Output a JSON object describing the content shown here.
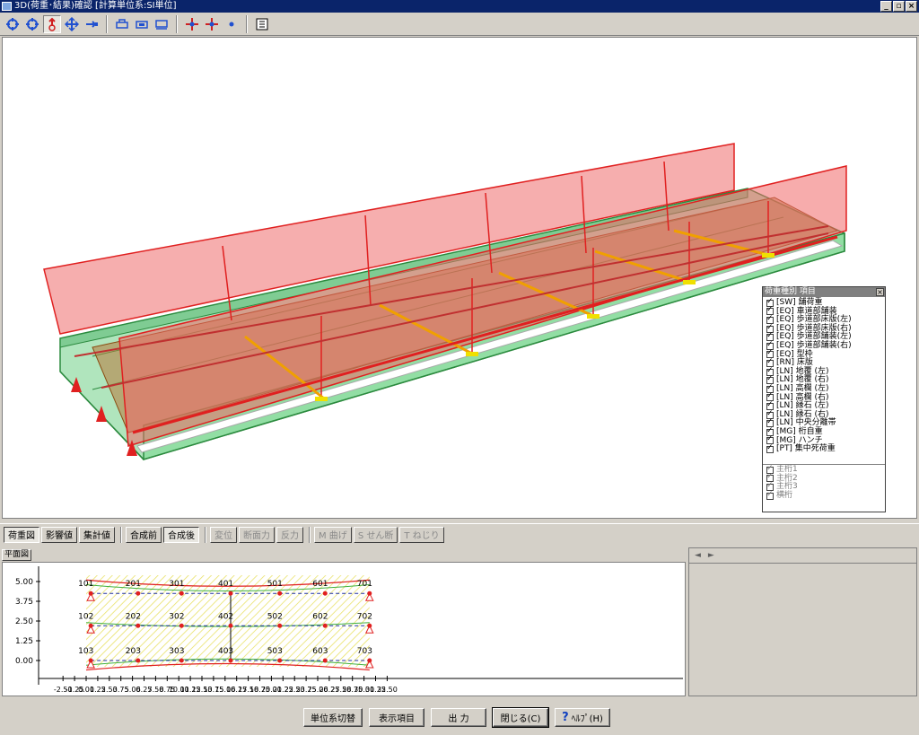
{
  "window": {
    "title": "3D(荷重･結果)確認 [計算単位系:SI単位]"
  },
  "toolbar": {
    "icons": [
      "rotate-x-icon",
      "rotate-y-icon",
      "rotate-z-icon",
      "move-icon",
      "zoom-icon",
      "front-view-icon",
      "side-view-icon",
      "top-view-icon",
      "node-icon",
      "member-icon",
      "point-icon",
      "settings-icon"
    ]
  },
  "legend": {
    "title": "荷重種別 項目",
    "items": [
      "[SW] 舗荷重",
      "[EQ] 車道部舗装",
      "[EQ] 歩道部床版(左)",
      "[EQ] 歩道部床版(右)",
      "[EQ] 歩道部舗装(左)",
      "[EQ] 歩道部舗装(右)",
      "[EQ] 型枠",
      "[RN] 床版",
      "[LN] 地覆 (左)",
      "[LN] 地覆 (右)",
      "[LN] 高欄 (左)",
      "[LN] 高欄 (右)",
      "[LN] 縁石 (左)",
      "[LN] 縁石 (右)",
      "[LN] 中央分離帯",
      "[MG] 桁自重",
      "[MG] ハンチ",
      "[PT] 集中死荷重"
    ],
    "girders": [
      "主桁1",
      "主桁2",
      "主桁3",
      "横桁"
    ]
  },
  "tabs": {
    "group1": [
      "荷重図",
      "影響値",
      "集計値"
    ],
    "group2": [
      "合成前",
      "合成後"
    ],
    "group3": [
      "変位",
      "断面力",
      "反力"
    ],
    "group4": [
      "M 曲げ",
      "S せん断",
      "T ねじり"
    ]
  },
  "plan": {
    "label": "平面図",
    "y_ticks": [
      "5.00",
      "3.75",
      "2.50",
      "1.25",
      "0.00"
    ],
    "x_ticks": [
      "-2.50",
      "-1.25",
      "0.00",
      "1.25",
      "2.50",
      "3.75",
      "5.00",
      "6.25",
      "7.50",
      "8.75",
      "10.00",
      "11.25",
      "12.50",
      "13.75",
      "15.00",
      "16.25",
      "17.50",
      "18.75",
      "20.00",
      "21.25",
      "22.50",
      "23.75",
      "25.00",
      "26.25",
      "27.50",
      "28.75",
      "30.00",
      "31.25",
      "32.50"
    ],
    "rows": [
      {
        "y": 4.25,
        "nodes": [
          "101",
          "201",
          "301",
          "401",
          "501",
          "601",
          "701"
        ]
      },
      {
        "y": 2.2,
        "nodes": [
          "102",
          "202",
          "302",
          "402",
          "502",
          "602",
          "702"
        ]
      },
      {
        "y": 0.0,
        "nodes": [
          "103",
          "203",
          "303",
          "403",
          "503",
          "603",
          "703"
        ]
      }
    ]
  },
  "sidepanel": {
    "arrows": [
      "◄",
      "►"
    ]
  },
  "buttons": {
    "unit": "単位系切替",
    "display": "表示項目",
    "output": "出 力",
    "close": "閉じる(C)",
    "help": "ﾍﾙﾌﾟ(H)"
  }
}
